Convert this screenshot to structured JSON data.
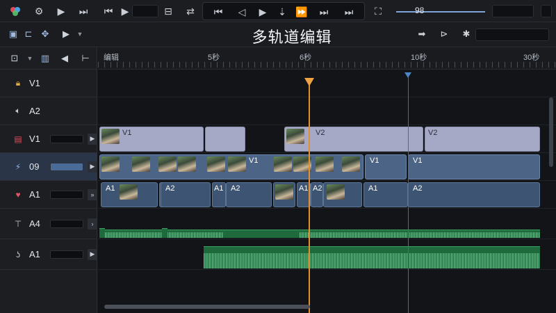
{
  "toolbar": {
    "slider_value": "98",
    "icons": [
      "app-logo-icon",
      "settings-icon",
      "play-icon",
      "step-forward-icon",
      "skip-back-icon",
      "play-icon",
      "minus-icon",
      "swap-icon",
      "jump-start-icon",
      "prev-frame-icon",
      "play-icon",
      "marker-down-icon",
      "fast-forward-icon",
      "next-frame-icon",
      "jump-end-icon",
      "fullscreen-icon"
    ]
  },
  "editor": {
    "title": "多轨道编辑"
  },
  "ruler": {
    "labels": [
      "编辑",
      "5秒",
      "6秒",
      "10秒",
      "30秒"
    ]
  },
  "tracks": [
    {
      "name": "V1",
      "icon": "lock-icon"
    },
    {
      "name": "A2",
      "icon": "speaker-icon"
    },
    {
      "name": "V1",
      "icon": "film-icon"
    },
    {
      "name": "09",
      "icon": "effects-icon"
    },
    {
      "name": "A1",
      "icon": "heart-icon"
    },
    {
      "name": "A4",
      "icon": "mic-icon"
    },
    {
      "name": "A1",
      "icon": "audio-hook-icon"
    }
  ],
  "clips": {
    "lane_v": [
      "V1",
      "V2",
      "V2"
    ],
    "lane_09": [
      "V1",
      "V1",
      "V1"
    ],
    "lane_a1": [
      "A1",
      "A1",
      "A2",
      "A1",
      "A2",
      "A1",
      "A2",
      "A1",
      "A2"
    ]
  },
  "colors": {
    "playhead": "#e5902e",
    "marker": "#3a6fa8",
    "video_clip": "#a6a9c6",
    "blue_clip": "#4c6586",
    "audio": "#1f6a3d"
  }
}
